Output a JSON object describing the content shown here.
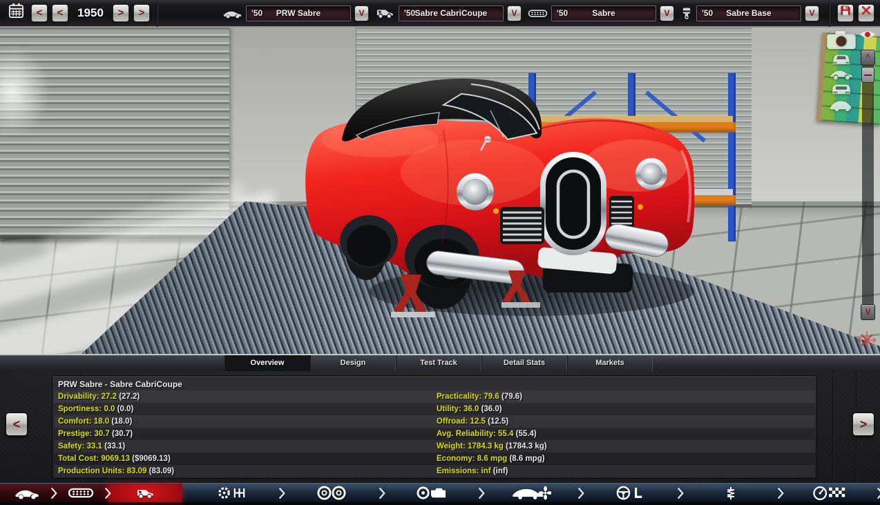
{
  "topbar": {
    "year": "1950",
    "prev_buttons": [
      "<",
      "<"
    ],
    "next_buttons": [
      ">",
      ">"
    ],
    "calendar_icon": "calendar-icon",
    "selectors": [
      {
        "icon": "car-model-icon",
        "prefix": "'50",
        "name": "PRW Sabre",
        "dropdown": "V"
      },
      {
        "icon": "car-trim-icon",
        "prefix": "'50",
        "name": "Sabre CabriCoupe",
        "dropdown": "V"
      },
      {
        "icon": "engine-family-icon",
        "prefix": "'50",
        "name": "Sabre",
        "dropdown": "V"
      },
      {
        "icon": "engine-variant-icon",
        "prefix": "'50",
        "name": "Sabre Base",
        "dropdown": "V"
      }
    ],
    "save_icon": "save-icon",
    "close_icon": "close-icon"
  },
  "viewport": {
    "camera_tools": [
      "photo-camera-icon",
      "car-front-view-icon",
      "car-side-view-icon",
      "car-rear-view-icon",
      "car-perspective-view-icon"
    ],
    "eye_icon": "visibility-eye-icon",
    "scrollbar": {
      "up": "^",
      "down": "V"
    }
  },
  "tabs": [
    {
      "label": "Overview",
      "active": true
    },
    {
      "label": "Design",
      "active": false
    },
    {
      "label": "Test Track",
      "active": false
    },
    {
      "label": "Detail Stats",
      "active": false
    },
    {
      "label": "Markets",
      "active": false
    }
  ],
  "stats": {
    "title": "PRW Sabre - Sabre CabriCoupe",
    "prev_arrow": "<",
    "next_arrow": ">",
    "left": [
      {
        "label": "Drivability",
        "value": "27.2",
        "paren": "(27.2)"
      },
      {
        "label": "Sportiness",
        "value": "0.0",
        "paren": "(0.0)"
      },
      {
        "label": "Comfort",
        "value": "18.0",
        "paren": "(18.0)"
      },
      {
        "label": "Prestige",
        "value": "30.7",
        "paren": "(30.7)"
      },
      {
        "label": "Safety",
        "value": "33.1",
        "paren": "(33.1)"
      },
      {
        "label": "Total Cost",
        "value": "9069.13",
        "paren": "($9069.13)"
      },
      {
        "label": "Production Units",
        "value": "83.09",
        "paren": "(83.09)"
      }
    ],
    "right": [
      {
        "label": "Practicality",
        "value": "79.6",
        "paren": "(79.6)"
      },
      {
        "label": "Utility",
        "value": "36.0",
        "paren": "(36.0)"
      },
      {
        "label": "Offroad",
        "value": "12.5",
        "paren": "(12.5)"
      },
      {
        "label": "Avg. Reliability",
        "value": "55.4",
        "paren": "(55.4)"
      },
      {
        "label": "Weight",
        "value": "1784.3 kg",
        "paren": "(1784.3 kg)"
      },
      {
        "label": "Economy",
        "value": "8.6 mpg",
        "paren": "(8.6 mpg)"
      },
      {
        "label": "Emissions",
        "value": "inf",
        "paren": "(inf)"
      }
    ]
  },
  "toolbar": {
    "items": [
      {
        "icon": "car-body-icon",
        "zone": "darkred",
        "active": false
      },
      {
        "icon": "chassis-icon",
        "zone": "darkred",
        "active": false
      },
      {
        "icon": "car-trim-icon",
        "zone": "active",
        "active": true
      },
      {
        "icon": "gearbox-icon",
        "zone": "navy",
        "active": false
      },
      {
        "icon": "wheels-icon",
        "zone": "navy",
        "active": false
      },
      {
        "icon": "engine-icon",
        "zone": "navy",
        "active": false
      },
      {
        "icon": "aero-icon",
        "zone": "navy",
        "active": false
      },
      {
        "icon": "interior-icon",
        "zone": "navy",
        "active": false
      },
      {
        "icon": "suspension-icon",
        "zone": "navy",
        "active": false
      },
      {
        "icon": "race-icon",
        "zone": "navy",
        "active": false
      }
    ]
  },
  "colors": {
    "accent_red": "#a8161b",
    "active_tool_red": "#c01016",
    "stat_yellow": "#dede00",
    "toolbar_navy": "#1d2b3e",
    "selector_maroon": "#351d24",
    "car_red": "#e8221c"
  }
}
